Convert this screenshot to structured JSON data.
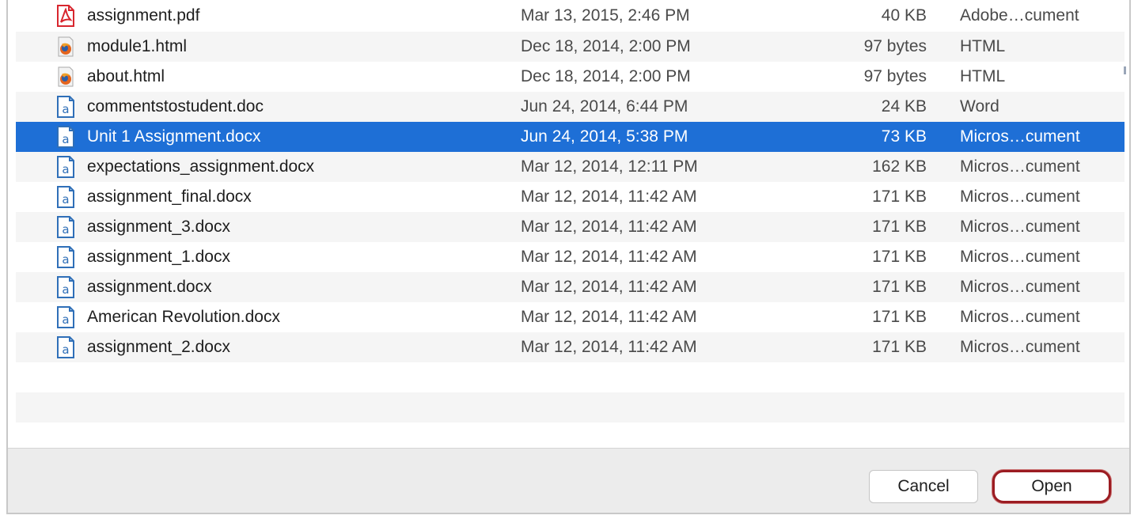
{
  "files": [
    {
      "name": "assignment.pdf",
      "date": "Mar 13, 2015, 2:46 PM",
      "size": "40 KB",
      "kind": "Adobe…cument",
      "icon": "pdf-icon",
      "selected": false
    },
    {
      "name": "module1.html",
      "date": "Dec 18, 2014, 2:00 PM",
      "size": "97 bytes",
      "kind": "HTML",
      "icon": "html-icon",
      "selected": false
    },
    {
      "name": "about.html",
      "date": "Dec 18, 2014, 2:00 PM",
      "size": "97 bytes",
      "kind": "HTML",
      "icon": "html-icon",
      "selected": false
    },
    {
      "name": "commentstostudent.doc",
      "date": "Jun 24, 2014, 6:44 PM",
      "size": "24 KB",
      "kind": "Word",
      "icon": "document-icon",
      "selected": false
    },
    {
      "name": "Unit 1 Assignment.docx",
      "date": "Jun 24, 2014, 5:38 PM",
      "size": "73 KB",
      "kind": "Micros…cument",
      "icon": "document-icon",
      "selected": true
    },
    {
      "name": "expectations_assignment.docx",
      "date": "Mar 12, 2014, 12:11 PM",
      "size": "162 KB",
      "kind": "Micros…cument",
      "icon": "document-icon",
      "selected": false
    },
    {
      "name": "assignment_final.docx",
      "date": "Mar 12, 2014, 11:42 AM",
      "size": "171 KB",
      "kind": "Micros…cument",
      "icon": "document-icon",
      "selected": false
    },
    {
      "name": "assignment_3.docx",
      "date": "Mar 12, 2014, 11:42 AM",
      "size": "171 KB",
      "kind": "Micros…cument",
      "icon": "document-icon",
      "selected": false
    },
    {
      "name": "assignment_1.docx",
      "date": "Mar 12, 2014, 11:42 AM",
      "size": "171 KB",
      "kind": "Micros…cument",
      "icon": "document-icon",
      "selected": false
    },
    {
      "name": "assignment.docx",
      "date": "Mar 12, 2014, 11:42 AM",
      "size": "171 KB",
      "kind": "Micros…cument",
      "icon": "document-icon",
      "selected": false
    },
    {
      "name": "American Revolution.docx",
      "date": "Mar 12, 2014, 11:42 AM",
      "size": "171 KB",
      "kind": "Micros…cument",
      "icon": "document-icon",
      "selected": false
    },
    {
      "name": "assignment_2.docx",
      "date": "Mar 12, 2014, 11:42 AM",
      "size": "171 KB",
      "kind": "Micros…cument",
      "icon": "document-icon",
      "selected": false
    }
  ],
  "buttons": {
    "cancel": "Cancel",
    "open": "Open"
  },
  "colors": {
    "selection": "#1e6fd6",
    "open_highlight": "#9b1c22",
    "pdf_red": "#d8262e",
    "doc_blue": "#2f6fb8"
  }
}
